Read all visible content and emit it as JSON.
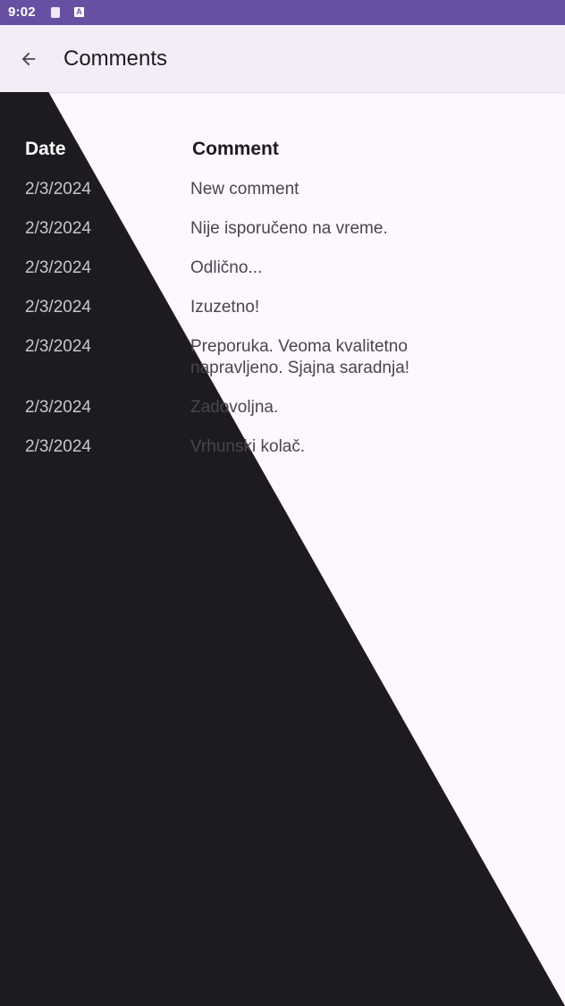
{
  "status_bar": {
    "time": "9:02",
    "icons": [
      "document-icon",
      "a-icon"
    ],
    "a_icon_glyph": "A"
  },
  "app_bar": {
    "title": "Comments",
    "back_icon": "arrow-back-icon"
  },
  "table": {
    "headers": {
      "date": "Date",
      "comment": "Comment"
    },
    "rows": [
      {
        "date": "2/3/2024",
        "comment": "New comment"
      },
      {
        "date": "2/3/2024",
        "comment": "Nije isporučeno na vreme."
      },
      {
        "date": "2/3/2024",
        "comment": "Odlično..."
      },
      {
        "date": "2/3/2024",
        "comment": "Izuzetno!"
      },
      {
        "date": "2/3/2024",
        "comment": "Preporuka. Veoma kvalitetno napravljeno. Sjajna saradnja!"
      },
      {
        "date": "2/3/2024",
        "comment": "Zadovoljna."
      },
      {
        "date": "2/3/2024",
        "comment": "Vrhunski kolač."
      }
    ]
  },
  "colors": {
    "status_bar": "#6750A4",
    "app_bar": "#F3EDF7",
    "background": "#FEF7FF",
    "overlay": "#1D1B20"
  }
}
